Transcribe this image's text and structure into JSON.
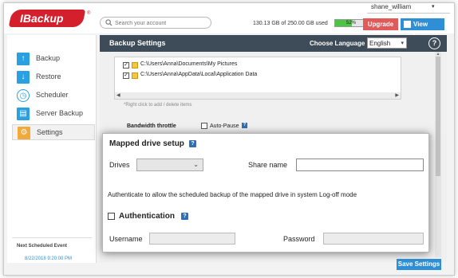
{
  "header": {
    "logo_text": "IBackup",
    "logo_mark": "®",
    "search_placeholder": "Search your account",
    "username": "shane_william",
    "user_caret": "▾",
    "storage_text": "130.13 GB of 250.00 GB used",
    "storage_percent_label": "52%",
    "storage_fraction": 0.52,
    "upgrade_label": "Upgrade",
    "view_logs_label": "View Logs",
    "brand_color": "#d41f2c"
  },
  "sidebar": {
    "items": [
      {
        "label": "Backup",
        "icon": "arrow-up-icon",
        "glyph": "↑"
      },
      {
        "label": "Restore",
        "icon": "arrow-down-icon",
        "glyph": "↓"
      },
      {
        "label": "Scheduler",
        "icon": "clock-icon",
        "glyph": "◷"
      },
      {
        "label": "Server Backup",
        "icon": "server-icon",
        "glyph": "▤"
      },
      {
        "label": "Settings",
        "icon": "gear-icon",
        "glyph": "⚙"
      }
    ],
    "active_item": "Settings",
    "next_scheduled_title": "Next Scheduled Event",
    "next_scheduled_time": "8/22/2018 9:20:00 PM"
  },
  "panel": {
    "title": "Backup Settings",
    "language_label": "Choose Language",
    "language_value": "English",
    "help_glyph": "?",
    "files": [
      "C:\\Users\\Anna\\Documents\\My Pictures",
      "C:\\Users\\Anna\\AppData\\Local\\Application Data"
    ],
    "file_hint": "*Right click to add / delete items",
    "bandwidth_label": "Bandwidth throttle",
    "auto_pause_label": "Auto-Pause",
    "save_label": "Save Settings"
  },
  "dialog": {
    "title": "Mapped drive setup",
    "drives_label": "Drives",
    "drives_value": "",
    "share_name_label": "Share name",
    "share_name_value": "",
    "auth_description": "Authenticate to allow the scheduled backup of the mapped drive in system Log-off mode",
    "authentication_label": "Authentication",
    "authentication_checked": false,
    "username_label": "Username",
    "username_value": "",
    "password_label": "Password",
    "password_value": ""
  }
}
